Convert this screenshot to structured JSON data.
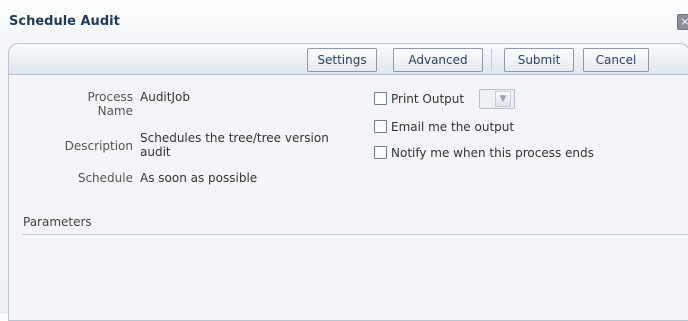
{
  "dialog": {
    "title": "Schedule Audit",
    "close_glyph": "×"
  },
  "toolbar": {
    "settings_label": "Settings",
    "advanced_label": "Advanced",
    "submit_label": "Submit",
    "cancel_label": "Cancel"
  },
  "process": {
    "name_label_line1": "Process",
    "name_label_line2": "Name",
    "name_value": "AuditJob",
    "description_label": "Description",
    "description_value_line1": "Schedules the tree/tree version",
    "description_value_line2": "audit",
    "schedule_label": "Schedule",
    "schedule_value": "As soon as possible"
  },
  "options": {
    "print_output_label": "Print Output",
    "print_output_checked": false,
    "email_output_label": "Email me the output",
    "email_output_checked": false,
    "notify_label": "Notify me when this process ends",
    "notify_checked": false
  },
  "parameters": {
    "section_label": "Parameters"
  },
  "icons": {
    "close": "close-icon",
    "dropdown": "chevron-down-icon"
  },
  "colors": {
    "title": "#1f3a5a",
    "panel_border": "#bcc6d3",
    "button_text": "#2b4460"
  }
}
